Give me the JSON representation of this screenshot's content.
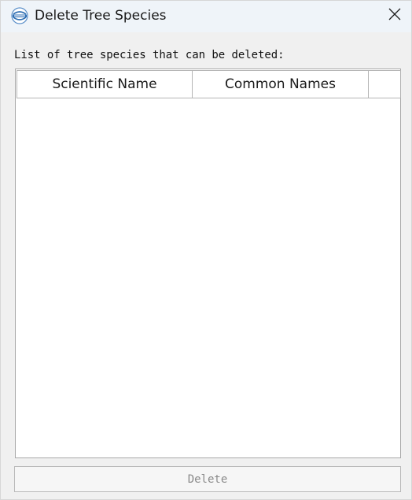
{
  "window": {
    "title": "Delete Tree Species",
    "app_icon": "globe-logo-icon",
    "close_icon": "close-icon"
  },
  "main": {
    "list_label": "List of tree species that can be deleted:",
    "table": {
      "columns": [
        "Scientific Name",
        "Common Names",
        ""
      ],
      "rows": []
    },
    "delete_label": "Delete",
    "delete_enabled": false
  }
}
